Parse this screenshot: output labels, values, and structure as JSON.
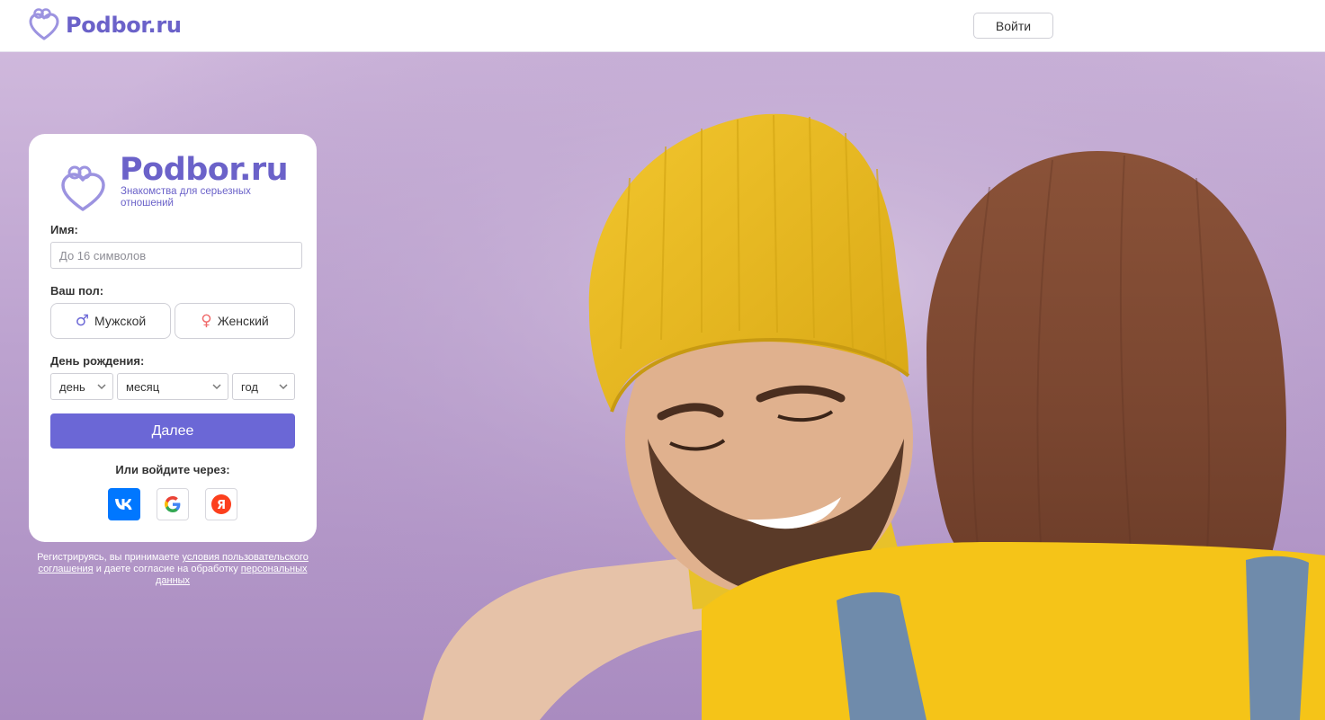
{
  "header": {
    "brand": "Podbor.ru",
    "login_label": "Войти"
  },
  "card": {
    "brand": "Podbor.ru",
    "tagline": "Знакомства для серьезных отношений",
    "name_label": "Имя:",
    "name_value": "",
    "name_placeholder": "До 16 символов",
    "gender_label": "Ваш пол:",
    "gender_male": "Мужской",
    "gender_female": "Женский",
    "birthday_label": "День рождения:",
    "day_value": "день",
    "month_value": "месяц",
    "year_value": "год",
    "next_label": "Далее",
    "or_login_label": "Или войдите через:",
    "social_icons": [
      "vk-icon",
      "google-icon",
      "yandex-icon"
    ],
    "yandex_letter": "Я"
  },
  "terms": {
    "prefix": "Регистрируясь, вы принимаете ",
    "link1": "условия пользовательского соглашения",
    "middle": " и даете согласие на обработку ",
    "link2": "персональных данных"
  },
  "colors": {
    "brand": "#6b62c9",
    "next_button": "#6b67d6",
    "background": "#bca2cf",
    "vk": "#0077ff",
    "yandex": "#fc3f1d",
    "male_symbol": "#6b67d6",
    "female_symbol": "#f06a6a"
  }
}
